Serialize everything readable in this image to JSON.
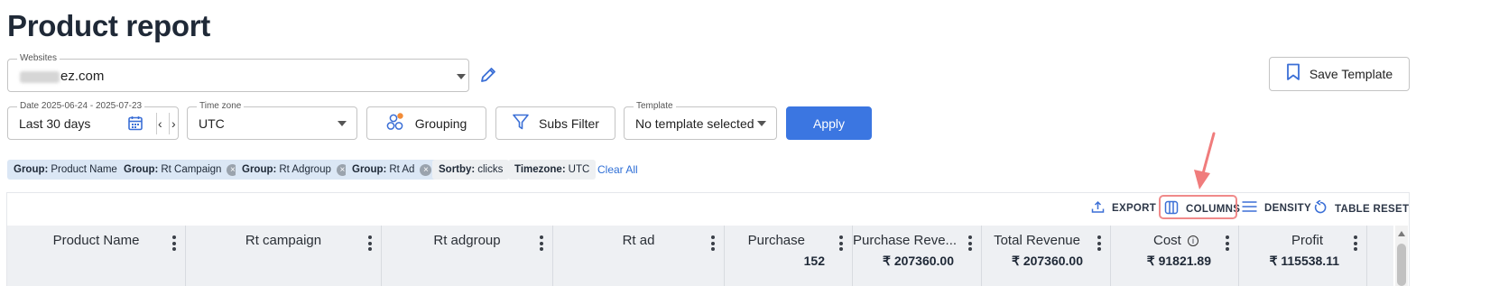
{
  "page": {
    "title": "Product report"
  },
  "websites": {
    "label": "Websites",
    "value_suffix": "ez.com"
  },
  "save_template": {
    "label": "Save Template"
  },
  "date": {
    "label": "Date 2025-06-24 - 2025-07-23",
    "value": "Last 30 days"
  },
  "timezone": {
    "label": "Time zone",
    "value": "UTC"
  },
  "grouping": {
    "label": "Grouping"
  },
  "subs_filter": {
    "label": "Subs Filter"
  },
  "template": {
    "label": "Template",
    "value": "No template selected"
  },
  "apply": {
    "label": "Apply"
  },
  "chips": [
    {
      "key": "Group:",
      "value": "Product Name"
    },
    {
      "key": "Group:",
      "value": "Rt Campaign"
    },
    {
      "key": "Group:",
      "value": "Rt Adgroup"
    },
    {
      "key": "Group:",
      "value": "Rt Ad"
    },
    {
      "key": "Sortby:",
      "value": "clicks"
    },
    {
      "key": "Timezone:",
      "value": "UTC"
    }
  ],
  "clear_all": "Clear All",
  "toolbar": {
    "export": "EXPORT",
    "columns": "COLUMNS",
    "density": "DENSITY",
    "table_reset": "TABLE RESET"
  },
  "columns": [
    {
      "label": "Product Name",
      "total": ""
    },
    {
      "label": "Rt campaign",
      "total": ""
    },
    {
      "label": "Rt adgroup",
      "total": ""
    },
    {
      "label": "Rt ad",
      "total": ""
    },
    {
      "label": "Purchase",
      "total": "152"
    },
    {
      "label": "Purchase Reve...",
      "total": "₹ 207360.00"
    },
    {
      "label": "Total Revenue",
      "total": "₹ 207360.00"
    },
    {
      "label": "Cost",
      "total": "₹ 91821.89"
    },
    {
      "label": "Profit",
      "total": "₹ 115538.11"
    }
  ],
  "colors": {
    "primary": "#3b76e1",
    "highlight": "#f08a8a",
    "chip_blue": "#dbe7f5",
    "header_bg": "#eef0f3"
  }
}
